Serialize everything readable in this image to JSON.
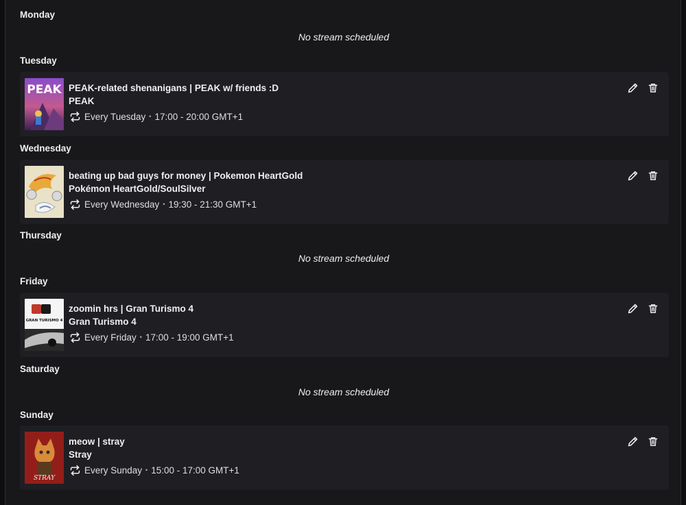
{
  "days": [
    {
      "label": "Monday",
      "empty_text": "No stream scheduled"
    },
    {
      "label": "Tuesday"
    },
    {
      "label": "Wednesday"
    },
    {
      "label": "Thursday",
      "empty_text": "No stream scheduled"
    },
    {
      "label": "Friday"
    },
    {
      "label": "Saturday",
      "empty_text": "No stream scheduled"
    },
    {
      "label": "Sunday"
    }
  ],
  "streams": [
    {
      "title": "PEAK-related shenanigans | PEAK w/ friends :D",
      "game": "PEAK",
      "cover_text": "PEAK",
      "recurrence": "Every Tuesday",
      "time": "17:00 - 20:00 GMT+1",
      "repeat_icon": "repeat-icon",
      "actions": [
        "edit-icon",
        "trash-icon"
      ]
    },
    {
      "title": "beating up bad guys for money | Pokemon HeartGold",
      "game": "Pokémon HeartGold/SoulSilver",
      "recurrence": "Every Wednesday",
      "time": "19:30 - 21:30 GMT+1",
      "repeat_icon": "repeat-icon",
      "actions": [
        "edit-icon",
        "trash-icon"
      ]
    },
    {
      "title": "zoomin hrs | Gran Turismo 4",
      "game": "Gran Turismo 4",
      "cover_text": "GRAN TURISMO 4",
      "recurrence": "Every Friday",
      "time": "17:00 - 19:00 GMT+1",
      "repeat_icon": "repeat-icon",
      "actions": [
        "edit-icon",
        "trash-icon"
      ]
    },
    {
      "title": "meow | stray",
      "game": "Stray",
      "cover_text": "STRAY",
      "recurrence": "Every Sunday",
      "time": "15:00 - 17:00 GMT+1",
      "repeat_icon": "repeat-icon",
      "actions": [
        "edit-icon",
        "trash-icon"
      ]
    }
  ],
  "separator": "•",
  "colors": {
    "page_bg": "#18181b",
    "card_bg": "#1f1f23",
    "text": "#efeff1"
  }
}
